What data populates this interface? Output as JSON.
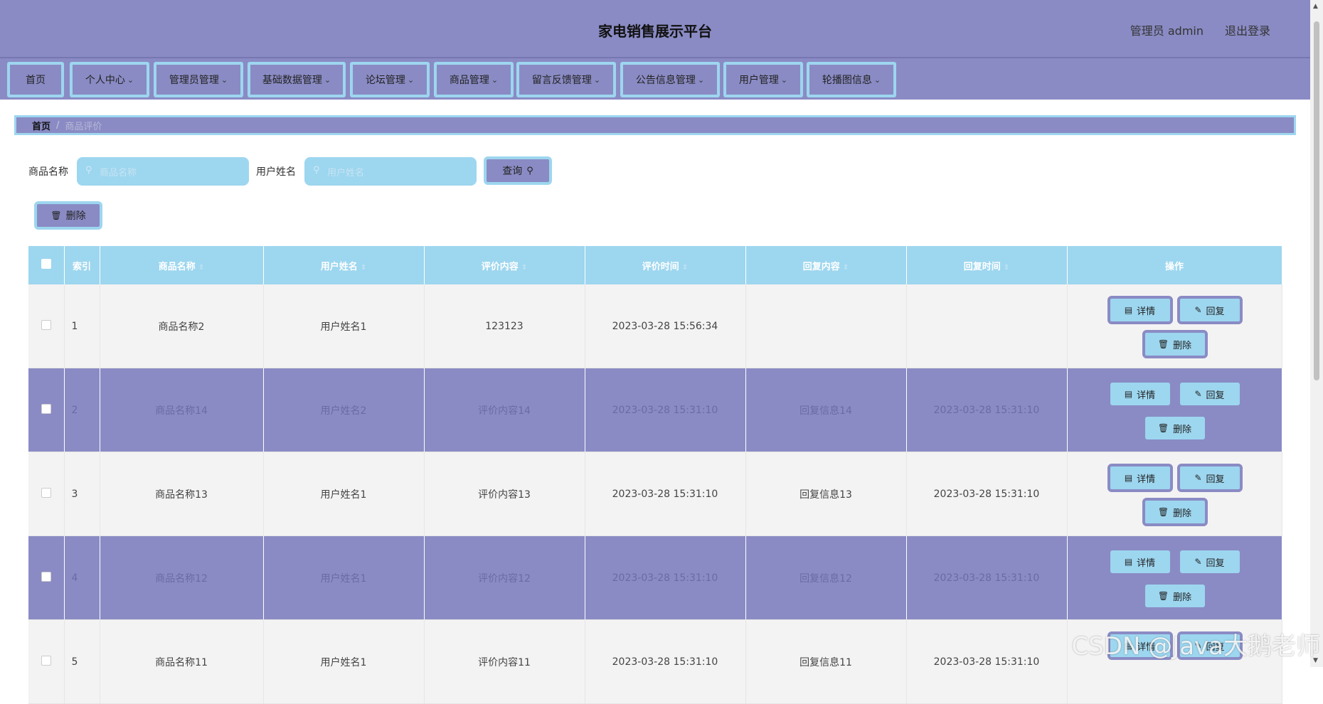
{
  "header": {
    "title": "家电销售展示平台",
    "user": "管理员 admin",
    "logout": "退出登录"
  },
  "nav": {
    "items": [
      {
        "label": "首页",
        "chevron": false
      },
      {
        "label": "个人中心",
        "chevron": true
      },
      {
        "label": "管理员管理",
        "chevron": true
      },
      {
        "label": "基础数据管理",
        "chevron": true
      },
      {
        "label": "论坛管理",
        "chevron": true
      },
      {
        "label": "商品管理",
        "chevron": true
      },
      {
        "label": "留言反馈管理",
        "chevron": true
      },
      {
        "label": "公告信息管理",
        "chevron": true
      },
      {
        "label": "用户管理",
        "chevron": true
      },
      {
        "label": "轮播图信息",
        "chevron": true
      }
    ]
  },
  "breadcrumb": {
    "home": "首页",
    "current": "商品评价"
  },
  "search": {
    "product_label": "商品名称",
    "product_placeholder": "商品名称",
    "user_label": "用户姓名",
    "user_placeholder": "用户姓名",
    "query_label": "查询"
  },
  "toolbar": {
    "delete_label": "删除"
  },
  "table": {
    "columns": [
      "索引",
      "商品名称",
      "用户姓名",
      "评价内容",
      "评价时间",
      "回复内容",
      "回复时间",
      "操作"
    ],
    "rows": [
      {
        "index": "1",
        "product": "商品名称2",
        "user": "用户姓名1",
        "content": "123123",
        "time": "2023-03-28 15:56:34",
        "reply": "",
        "reply_time": ""
      },
      {
        "index": "2",
        "product": "商品名称14",
        "user": "用户姓名2",
        "content": "评价内容14",
        "time": "2023-03-28 15:31:10",
        "reply": "回复信息14",
        "reply_time": "2023-03-28 15:31:10"
      },
      {
        "index": "3",
        "product": "商品名称13",
        "user": "用户姓名1",
        "content": "评价内容13",
        "time": "2023-03-28 15:31:10",
        "reply": "回复信息13",
        "reply_time": "2023-03-28 15:31:10"
      },
      {
        "index": "4",
        "product": "商品名称12",
        "user": "用户姓名1",
        "content": "评价内容12",
        "time": "2023-03-28 15:31:10",
        "reply": "回复信息12",
        "reply_time": "2023-03-28 15:31:10"
      },
      {
        "index": "5",
        "product": "商品名称11",
        "user": "用户姓名1",
        "content": "评价内容11",
        "time": "2023-03-28 15:31:10",
        "reply": "回复信息11",
        "reply_time": "2023-03-28 15:31:10"
      }
    ],
    "actions": {
      "detail": "详情",
      "reply": "回复",
      "delete": "删除"
    }
  },
  "watermark": "CSDN @Java大鹅老师",
  "colors": {
    "primary": "#8a8bc4",
    "accent": "#9dd6ef",
    "row_light": "#f3f3f3"
  }
}
